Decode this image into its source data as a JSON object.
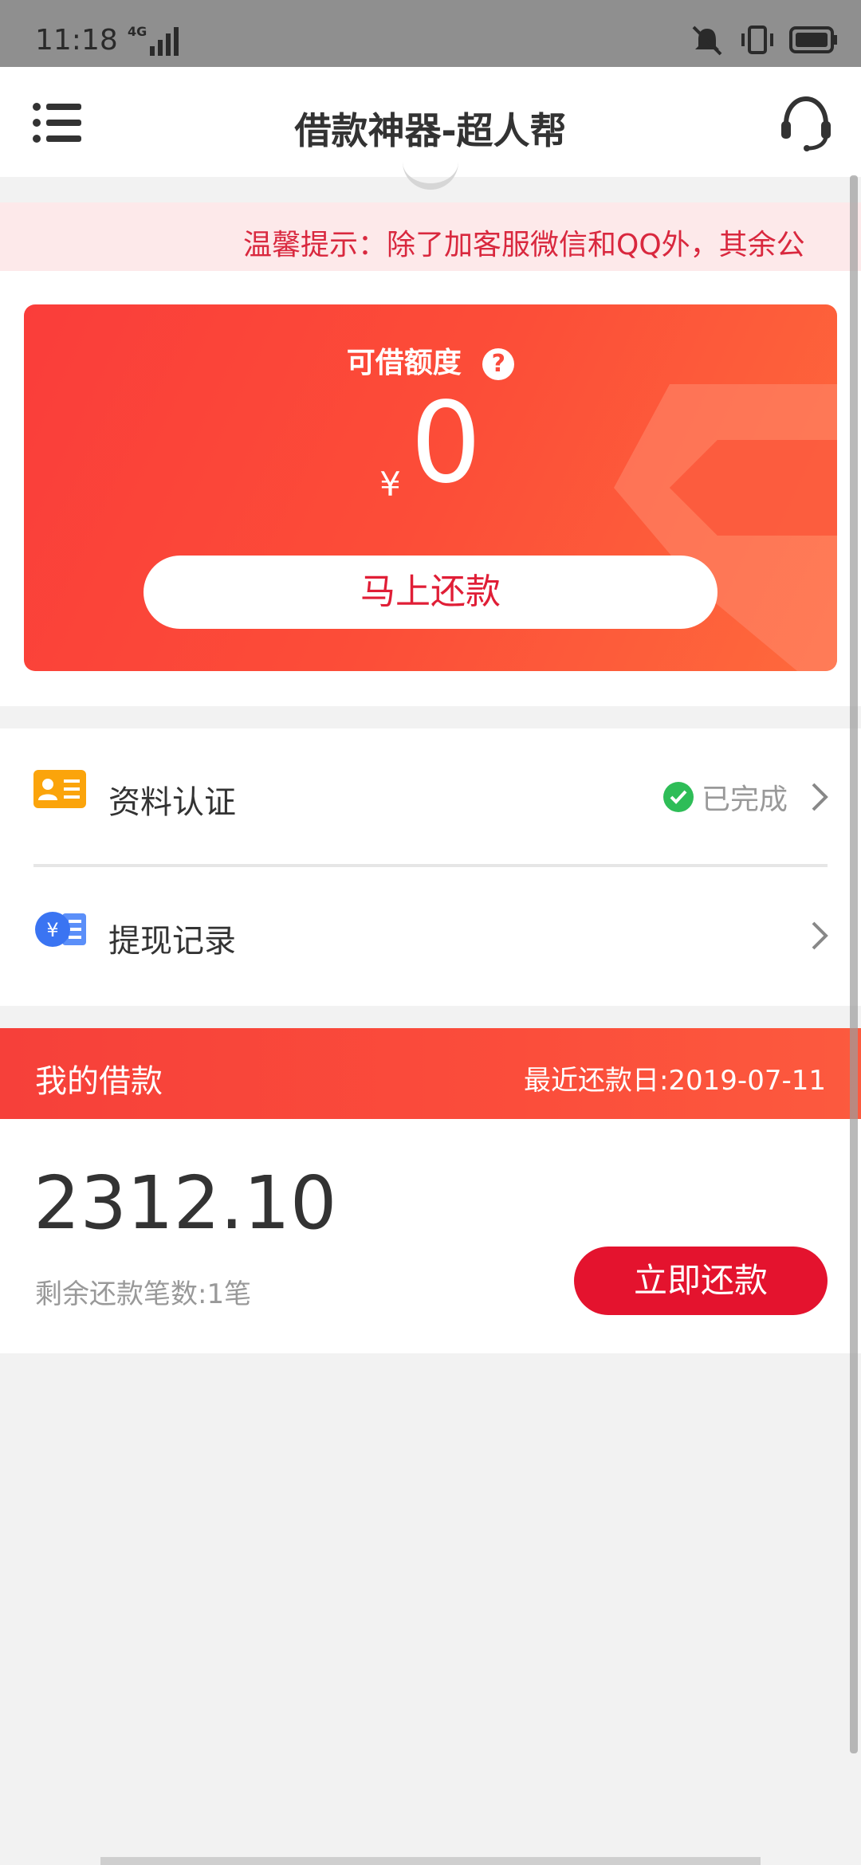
{
  "status_bar": {
    "time": "11:18",
    "network": "4G"
  },
  "header": {
    "title": "借款神器-超人帮"
  },
  "notice": {
    "text": "温馨提示：除了加客服微信和QQ外，其余公"
  },
  "credit": {
    "label": "可借额度",
    "help_icon_text": "?",
    "currency": "¥",
    "amount": "0",
    "repay_button": "马上还款"
  },
  "list": [
    {
      "label": "资料认证",
      "status": "已完成",
      "icon": "id-card-icon"
    },
    {
      "label": "提现记录",
      "icon": "withdraw-record-icon"
    }
  ],
  "loan": {
    "title": "我的借款",
    "recent_repay": "最近还款日:2019-07-11",
    "amount": "2312.10",
    "remaining": "剩余还款笔数:1笔",
    "repay_now": "立即还款"
  },
  "colors": {
    "accent": "#fa3d3a",
    "button_red": "#e4132e",
    "success": "#2ebd57"
  }
}
